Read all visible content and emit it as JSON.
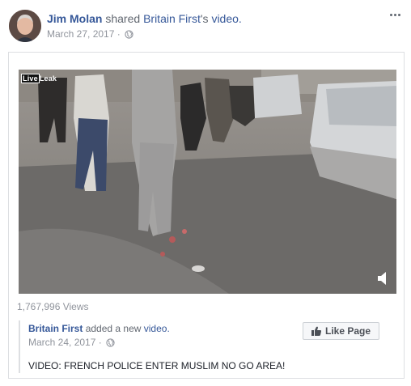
{
  "post": {
    "author": "Jim Molan",
    "action_prefix": "shared",
    "shared_page": "Britain First",
    "action_suffix": "'s",
    "object": "video.",
    "date": "March 27, 2017",
    "separator": "·"
  },
  "icons": {
    "more": "more-options-icon",
    "privacy": "globe-icon",
    "volume": "volume-icon",
    "like": "thumbs-up-icon"
  },
  "video": {
    "watermark_live": "Live",
    "watermark_leak": "Leak"
  },
  "stats": {
    "views": "1,767,996 Views"
  },
  "original_post": {
    "page_name": "Britain First",
    "action": "added a new",
    "object": "video.",
    "date": "March 24, 2017",
    "separator": "·",
    "caption": "VIDEO: FRENCH POLICE ENTER MUSLIM NO GO AREA!",
    "like_button": "Like Page"
  },
  "colors": {
    "link": "#365899",
    "muted": "#90949c",
    "border": "#dddfe2"
  }
}
